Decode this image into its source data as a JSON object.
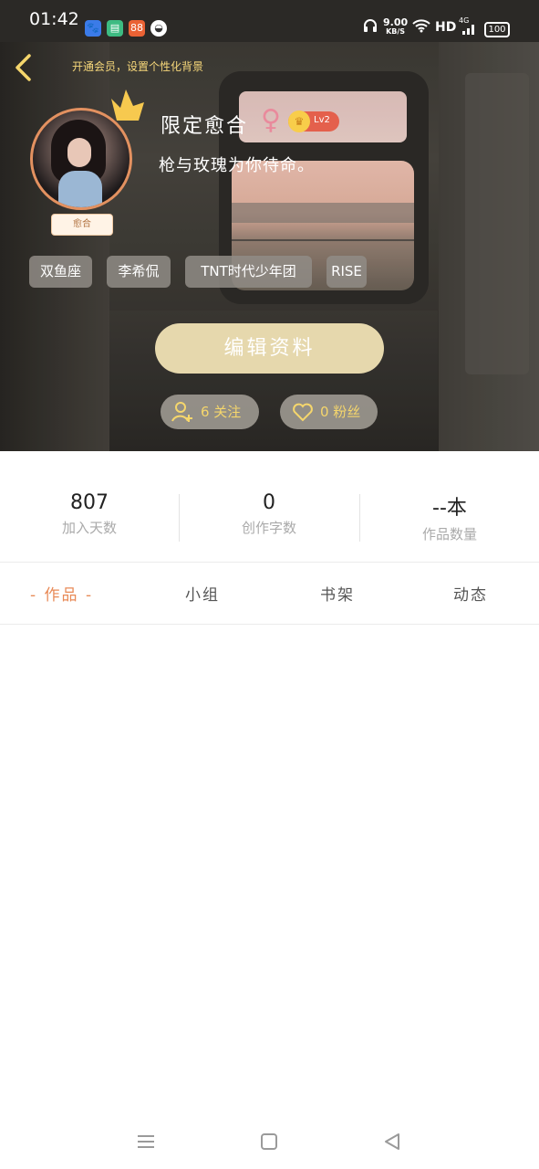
{
  "status_bar": {
    "time": "01:42",
    "apps": [
      "baidu-app-icon",
      "book-app-icon",
      "app-icon-88",
      "chat-app-icon"
    ],
    "speed_value": "9.00",
    "speed_unit": "KB/S",
    "hd": "HD",
    "network": "4G",
    "battery": "100"
  },
  "header": {
    "vip_tip": "开通会员，设置个性化背景",
    "avatar_tag": "愈合",
    "username": "限定愈合",
    "gender_symbol": "♀",
    "level": "Lv2",
    "signature": "枪与玫瑰为你待命。"
  },
  "tags": [
    "双鱼座",
    "李希侃",
    "TNT时代少年团",
    "RISE"
  ],
  "actions": {
    "edit_profile": "编辑资料",
    "following": "6 关注",
    "followers": "0 粉丝"
  },
  "stats": [
    {
      "value": "807",
      "label": "加入天数"
    },
    {
      "value": "0",
      "label": "创作字数"
    },
    {
      "value": "--本",
      "label": "作品数量"
    }
  ],
  "tabs": [
    {
      "label": "- 作品 -",
      "active": true
    },
    {
      "label": "小组",
      "active": false
    },
    {
      "label": "书架",
      "active": false
    },
    {
      "label": "动态",
      "active": false
    }
  ],
  "colors": {
    "accent": "#e88a57",
    "edit_button": "#e6d8ad",
    "pill_text": "#f5d66c"
  }
}
